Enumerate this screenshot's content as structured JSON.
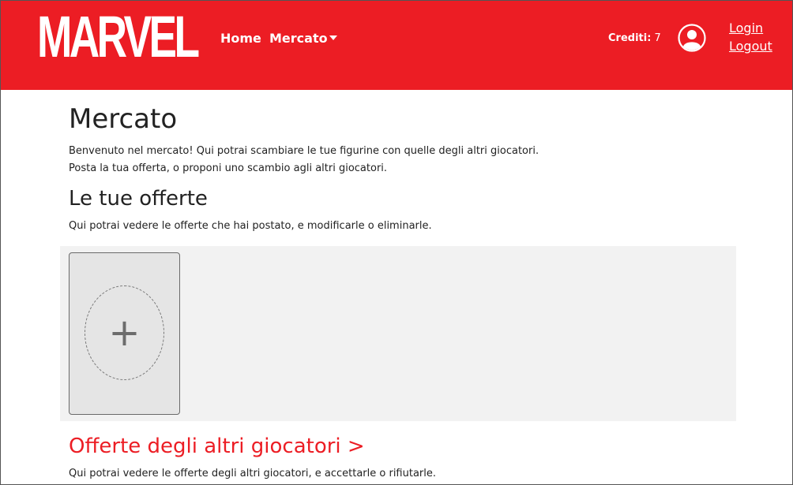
{
  "brand": {
    "logo_text": "MARVEL",
    "color": "#ec1d24"
  },
  "nav": {
    "home_label": "Home",
    "mercato_label": "Mercato",
    "credits_label": "Crediti:",
    "credits_value": "7",
    "login_label": "Login",
    "logout_label": "Logout"
  },
  "main": {
    "title": "Mercato",
    "intro_line1": "Benvenuto nel mercato! Qui potrai scambiare le tue figurine con quelle degli altri giocatori.",
    "intro_line2": "Posta la tua offerta, o proponi uno scambio agli altri giocatori.",
    "my_offers": {
      "title": "Le tue offerte",
      "description": "Qui potrai vedere le offerte che hai postato, e modificarle o eliminarle.",
      "add_symbol": "+"
    },
    "other_offers": {
      "title": "Offerte degli altri giocatori >",
      "description": "Qui potrai vedere le offerte degli altri giocatori, e accettarle o rifiutarle."
    }
  },
  "icons": {
    "avatar": "user-circle-icon",
    "dropdown": "caret-down-icon",
    "add": "plus-icon"
  }
}
